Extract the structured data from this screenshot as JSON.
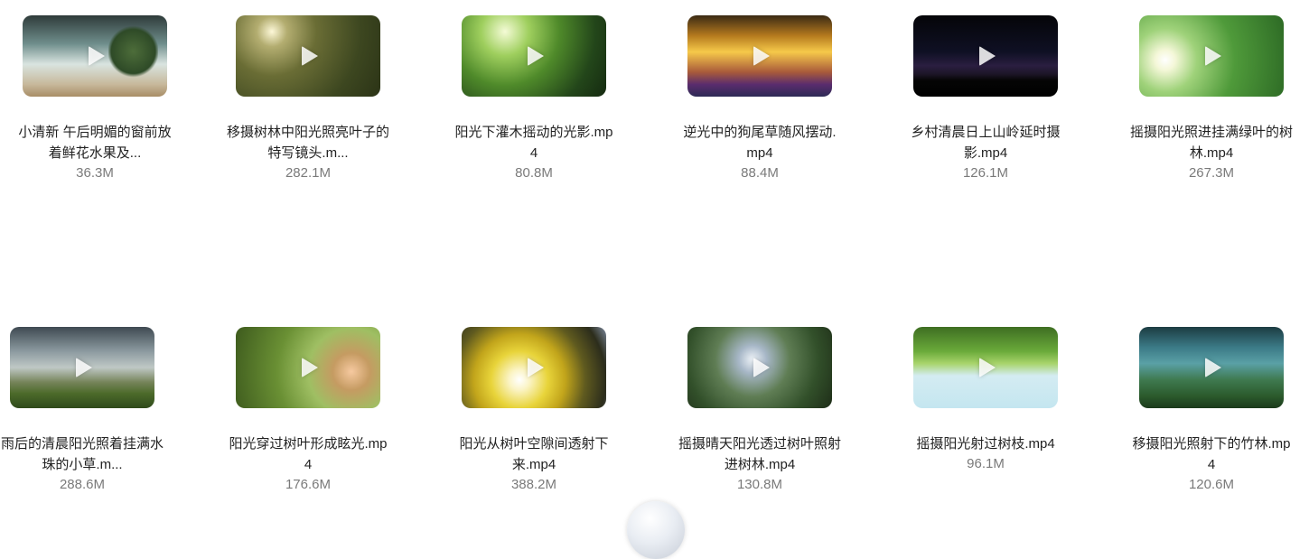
{
  "files": [
    {
      "name": "小清新 午后明媚的窗前放\n着鲜花水果及...",
      "size": "36.3M",
      "thumbnail": "window-flowers-fruit-scene"
    },
    {
      "name": "移摄树林中阳光照亮叶子的\n特写镜头.m...",
      "size": "282.1M",
      "thumbnail": "sunlit-forest-leaves-scene"
    },
    {
      "name": "阳光下灌木摇动的光影.mp\n4",
      "size": "80.8M",
      "thumbnail": "shrub-light-shadow-scene"
    },
    {
      "name": "逆光中的狗尾草随风摆动.\nmp4",
      "size": "88.4M",
      "thumbnail": "backlit-foxtail-grass-scene"
    },
    {
      "name": "乡村清晨日上山岭延时摄\n影.mp4",
      "size": "126.1M",
      "thumbnail": "village-dawn-timelapse-scene"
    },
    {
      "name": "摇摄阳光照进挂满绿叶的树\n林.mp4",
      "size": "267.3M",
      "thumbnail": "green-forest-sunbeam-scene"
    },
    {
      "name": "雨后的清晨阳光照着挂满水\n珠的小草.m...",
      "size": "288.6M",
      "thumbnail": "morning-dew-grass-scene"
    },
    {
      "name": "阳光穿过树叶形成眩光.mp\n4",
      "size": "176.6M",
      "thumbnail": "leaves-lens-flare-scene"
    },
    {
      "name": "阳光从树叶空隙间透射下\n来.mp4",
      "size": "388.2M",
      "thumbnail": "yellow-leaves-sunlight-scene"
    },
    {
      "name": "摇摄晴天阳光透过树叶照射\n进树林.mp4",
      "size": "130.8M",
      "thumbnail": "sunny-treetops-scene"
    },
    {
      "name": "摇摄阳光射过树枝.mp4",
      "size": "96.1M",
      "thumbnail": "branches-blue-sky-scene"
    },
    {
      "name": "移摄阳光照射下的竹林.mp\n4",
      "size": "120.6M",
      "thumbnail": "bamboo-forest-scene"
    }
  ]
}
